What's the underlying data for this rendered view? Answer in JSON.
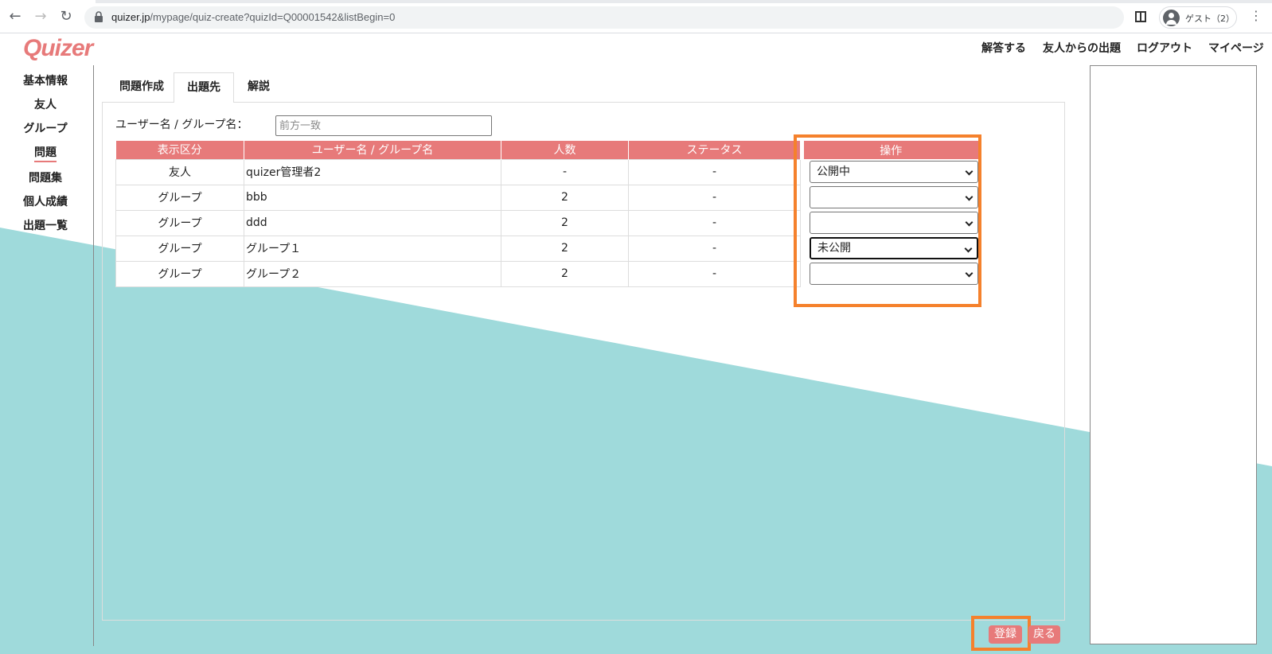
{
  "browser": {
    "url_domain": "quizer.jp",
    "url_path": "/mypage/quiz-create?quizId=Q00001542&listBegin=0",
    "profile_label": "ゲスト（2）"
  },
  "header": {
    "logo": "Quizer",
    "nav": [
      "解答する",
      "友人からの出題",
      "ログアウト",
      "マイページ"
    ]
  },
  "sidebar": {
    "items": [
      "基本情報",
      "友人",
      "グループ",
      "問題",
      "問題集",
      "個人成績",
      "出題一覧"
    ],
    "active": "問題"
  },
  "tabs": [
    "問題作成",
    "出題先",
    "解説"
  ],
  "filter": {
    "label": "ユーザー名 / グループ名：",
    "placeholder": "前方一致"
  },
  "table": {
    "columns": [
      "表示区分",
      "ユーザー名 / グループ名",
      "人数",
      "ステータス",
      "操作"
    ],
    "rows": [
      {
        "type": "友人",
        "name": "quizer管理者2",
        "count": "-",
        "status": "-",
        "op": "公開中"
      },
      {
        "type": "グループ",
        "name": "bbb",
        "count": "2",
        "status": "-",
        "op": ""
      },
      {
        "type": "グループ",
        "name": "ddd",
        "count": "2",
        "status": "-",
        "op": ""
      },
      {
        "type": "グループ",
        "name": "グループ１",
        "count": "2",
        "status": "-",
        "op": "未公開"
      },
      {
        "type": "グループ",
        "name": "グループ２",
        "count": "2",
        "status": "-",
        "op": ""
      }
    ]
  },
  "buttons": {
    "register": "登録",
    "back": "戻る"
  },
  "colors": {
    "accent": "#e77a7a",
    "highlight": "#f5812c",
    "teal": "#9fdadb"
  }
}
